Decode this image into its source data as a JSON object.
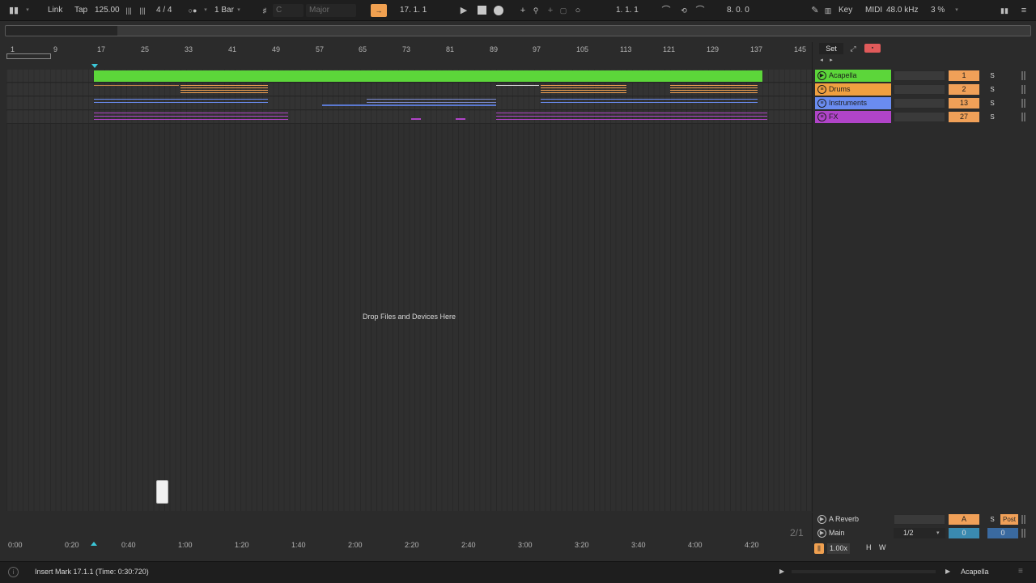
{
  "transport": {
    "link": "Link",
    "tap": "Tap",
    "tempo": "125.00",
    "time_signature": "4 / 4",
    "quantize": "1 Bar",
    "key_root": "C",
    "scale": "Major",
    "position": "17.  1.  1",
    "loop_start": "1.  1.  1",
    "loop_length": "8.  0.  0",
    "key_label": "Key",
    "midi_label": "MIDI",
    "sample_rate": "48.0 kHz",
    "cpu": "3 %"
  },
  "ruler": {
    "bars": [
      "1",
      "9",
      "17",
      "25",
      "33",
      "41",
      "49",
      "57",
      "65",
      "73",
      "81",
      "89",
      "97",
      "105",
      "113",
      "121",
      "129",
      "137",
      "145"
    ]
  },
  "set_label": "Set",
  "drop_text": "Drop Files and Devices Here",
  "tracks": [
    {
      "name": "Acapella",
      "number": "1",
      "solo": "S",
      "color": "#5cd63a"
    },
    {
      "name": "Drums",
      "number": "2",
      "solo": "S",
      "color": "#f0a040"
    },
    {
      "name": "Instruments",
      "number": "13",
      "solo": "S",
      "color": "#6a8cf0"
    },
    {
      "name": "FX",
      "number": "27",
      "solo": "S",
      "color": "#b044c8"
    }
  ],
  "returns": [
    {
      "name": "A Reverb",
      "send": "A",
      "solo": "S",
      "post": "Post"
    },
    {
      "name": "Main",
      "routing": "1/2",
      "left": "0",
      "right": "0"
    }
  ],
  "grid_label": "2/1",
  "zoom": "1.00x",
  "h_label": "H",
  "w_label": "W",
  "time_ruler": [
    "0:00",
    "0:20",
    "0:40",
    "1:00",
    "1:20",
    "1:40",
    "2:00",
    "2:20",
    "2:40",
    "3:00",
    "3:20",
    "3:40",
    "4:00",
    "4:20"
  ],
  "status": {
    "message": "Insert Mark 17.1.1 (Time: 0:30:720)",
    "selected_track": "Acapella"
  }
}
